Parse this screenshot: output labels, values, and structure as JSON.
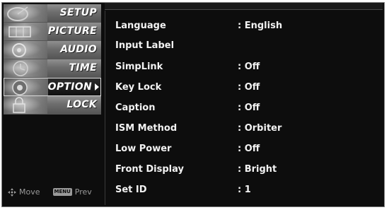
{
  "sidebar": {
    "items": [
      {
        "label": "SETUP",
        "active": false,
        "icon": "satellite-dish-icon"
      },
      {
        "label": "PICTURE",
        "active": false,
        "icon": "film-strip-icon"
      },
      {
        "label": "AUDIO",
        "active": false,
        "icon": "speaker-icon"
      },
      {
        "label": "TIME",
        "active": false,
        "icon": "clock-icon"
      },
      {
        "label": "OPTION",
        "active": true,
        "icon": "option-dial-icon"
      },
      {
        "label": "LOCK",
        "active": false,
        "icon": "lock-icon"
      }
    ]
  },
  "hints": {
    "move_label": "Move",
    "menu_key": "MENU",
    "prev_label": "Prev"
  },
  "settings": [
    {
      "name": "Language",
      "value": ": English"
    },
    {
      "name": "Input Label",
      "value": ""
    },
    {
      "name": "SimpLink",
      "value": ": Off"
    },
    {
      "name": "Key Lock",
      "value": ": Off"
    },
    {
      "name": "Caption",
      "value": ": Off"
    },
    {
      "name": "ISM Method",
      "value": ": Orbiter"
    },
    {
      "name": "Low Power",
      "value": ": Off"
    },
    {
      "name": "Front Display",
      "value": ": Bright"
    },
    {
      "name": "Set ID",
      "value": ": 1"
    }
  ],
  "colors": {
    "background": "#0d0d0d",
    "text": "#f2f2f2",
    "active_border": "#d8d8d8"
  }
}
